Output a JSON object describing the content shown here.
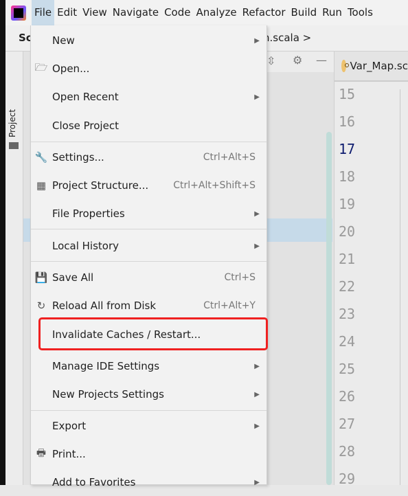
{
  "menubar": {
    "items": [
      "File",
      "Edit",
      "View",
      "Navigate",
      "Code",
      "Analyze",
      "Refactor",
      "Build",
      "Run",
      "Tools"
    ],
    "active": "File"
  },
  "breadcrumb": {
    "left": "Sc",
    "right": "h.scala >"
  },
  "sidebar": {
    "project_label": "Project"
  },
  "editor": {
    "tab": "Var_Map.sc",
    "line_numbers": [
      "15",
      "16",
      "17",
      "18",
      "19",
      "20",
      "21",
      "22",
      "23",
      "24",
      "25",
      "26",
      "27",
      "28",
      "29"
    ],
    "current_line": "17"
  },
  "file_menu": {
    "items": [
      {
        "label": "New",
        "submenu": true
      },
      {
        "label": "Open...",
        "icon": "folder-icon"
      },
      {
        "label": "Open Recent",
        "submenu": true
      },
      {
        "label": "Close Project"
      },
      {
        "label": "Settings...",
        "icon": "wrench-icon",
        "shortcut": "Ctrl+Alt+S"
      },
      {
        "label": "Project Structure...",
        "icon": "project-structure-icon",
        "shortcut": "Ctrl+Alt+Shift+S"
      },
      {
        "label": "File Properties",
        "submenu": true
      },
      {
        "label": "Local History",
        "submenu": true
      },
      {
        "label": "Save All",
        "icon": "save-icon",
        "shortcut": "Ctrl+S"
      },
      {
        "label": "Reload All from Disk",
        "icon": "reload-icon",
        "shortcut": "Ctrl+Alt+Y"
      },
      {
        "label": "Invalidate Caches / Restart...",
        "highlighted": true
      },
      {
        "label": "Manage IDE Settings",
        "submenu": true
      },
      {
        "label": "New Projects Settings",
        "submenu": true
      },
      {
        "label": "Export",
        "submenu": true
      },
      {
        "label": "Print...",
        "icon": "print-icon"
      },
      {
        "label": "Add to Favorites",
        "submenu": true
      }
    ]
  },
  "colors": {
    "highlight_box": "#ef2020",
    "menu_active": "#c9dbe9"
  }
}
